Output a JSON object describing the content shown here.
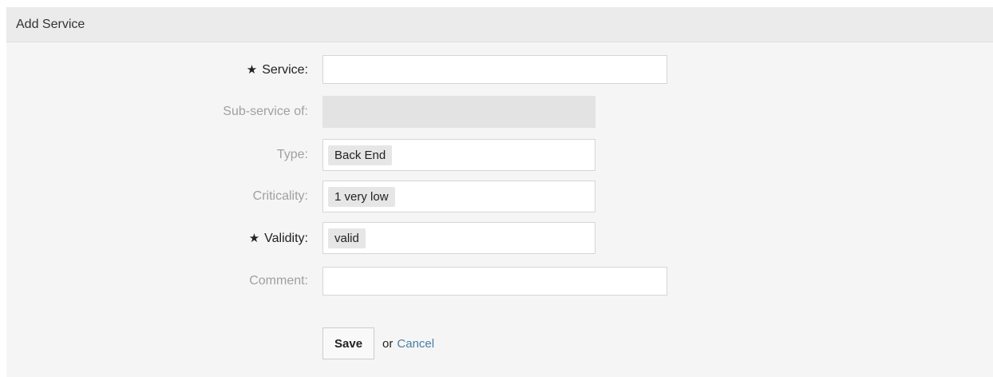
{
  "panel": {
    "title": "Add Service"
  },
  "form": {
    "service": {
      "label": "Service:",
      "required": true,
      "value": ""
    },
    "sub_service_of": {
      "label": "Sub-service of:",
      "value": ""
    },
    "type": {
      "label": "Type:",
      "selected": "Back End"
    },
    "criticality": {
      "label": "Criticality:",
      "selected": "1 very low"
    },
    "validity": {
      "label": "Validity:",
      "required": true,
      "selected": "valid"
    },
    "comment": {
      "label": "Comment:",
      "value": ""
    }
  },
  "actions": {
    "save_label": "Save",
    "or_text": "or",
    "cancel_label": "Cancel"
  },
  "icons": {
    "required_marker": "asterisk-icon"
  }
}
